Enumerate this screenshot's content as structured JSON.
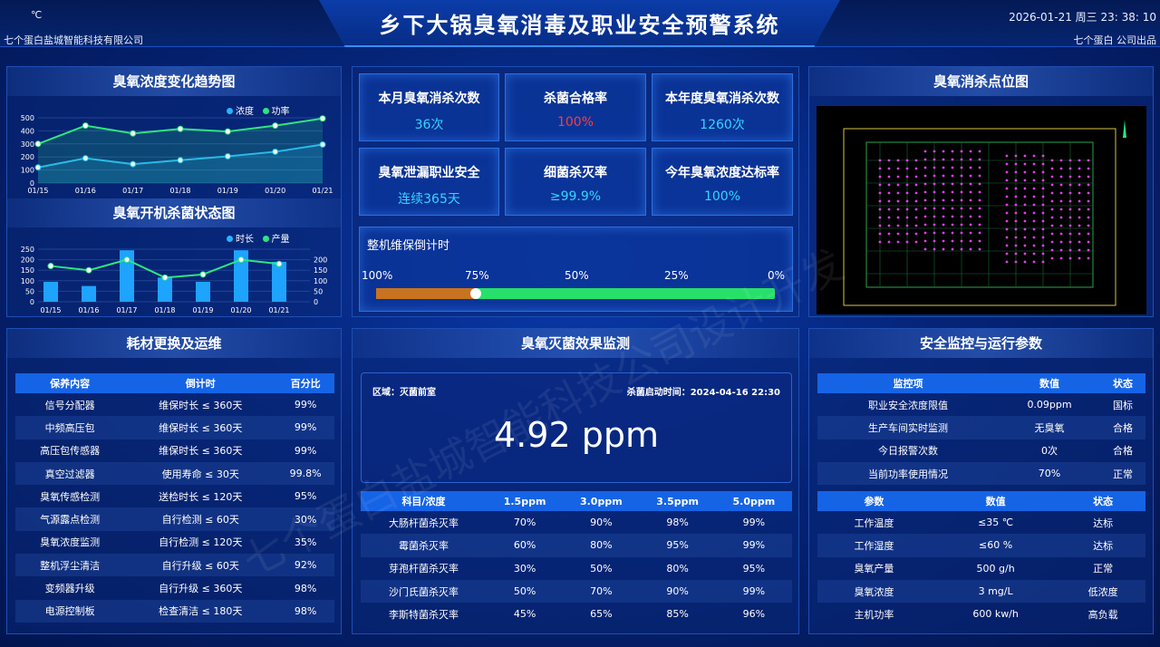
{
  "header": {
    "title": "乡下大锅臭氧消毒及职业安全预警系统",
    "weather_unit": "℃",
    "company": "七个蛋白盐城智能科技有限公司",
    "datetime": "2026-01-21 周三 23: 38: 10",
    "made_by": "七个蛋白 公司出品",
    "watermark": "七个蛋白盐城智能科技公司设计开发"
  },
  "trend": {
    "title": "臭氧浓度变化趋势图",
    "legend": [
      "浓度",
      "功率"
    ],
    "colors": [
      "#27b3ff",
      "#2ee57f"
    ]
  },
  "status": {
    "title": "臭氧开机杀菌状态图",
    "legend": [
      "时长",
      "产量"
    ]
  },
  "chart_data": [
    {
      "type": "area",
      "title": "臭氧浓度变化趋势图",
      "x": [
        "01/15",
        "01/16",
        "01/17",
        "01/18",
        "01/19",
        "01/20",
        "01/21"
      ],
      "ylim": [
        0,
        500
      ],
      "yticks": [
        0,
        100,
        200,
        300,
        400,
        500
      ],
      "series": [
        {
          "name": "浓度",
          "values": [
            120,
            190,
            145,
            175,
            205,
            240,
            295
          ]
        },
        {
          "name": "功率",
          "values": [
            300,
            440,
            380,
            415,
            395,
            440,
            495
          ]
        }
      ]
    },
    {
      "type": "bar",
      "title": "臭氧开机杀菌状态图",
      "x": [
        "01/15",
        "01/16",
        "01/17",
        "01/18",
        "01/19",
        "01/20",
        "01/21"
      ],
      "ylim": [
        0,
        250
      ],
      "yticks": [
        0,
        50,
        100,
        150,
        200,
        250
      ],
      "y2ticks": [
        0,
        50,
        100,
        150,
        200
      ],
      "series": [
        {
          "name": "时长",
          "values": [
            95,
            75,
            245,
            115,
            95,
            245,
            190
          ]
        },
        {
          "name": "产量",
          "values": [
            170,
            150,
            200,
            115,
            130,
            200,
            180
          ]
        }
      ]
    }
  ],
  "kpis": [
    {
      "label": "本月臭氧消杀次数",
      "value": "36次",
      "color": "#33d6ff"
    },
    {
      "label": "杀菌合格率",
      "value": "100%",
      "color": "#ff3c3c"
    },
    {
      "label": "本年度臭氧消杀次数",
      "value": "1260次",
      "color": "#33d6ff"
    },
    {
      "label": "臭氧泄漏职业安全",
      "value": "连续365天",
      "color": "#33d6ff"
    },
    {
      "label": "细菌杀灭率",
      "value": "≥99.9%",
      "color": "#33d6ff"
    },
    {
      "label": "今年臭氧浓度达标率",
      "value": "100%",
      "color": "#33d6ff"
    }
  ],
  "maintenance": {
    "title": "整机维保倒计时",
    "ticks": [
      "100%",
      "75%",
      "50%",
      "25%",
      "0%"
    ],
    "progress": 0.75
  },
  "map": {
    "title": "臭氧消杀点位图"
  },
  "consumables": {
    "title": "耗材更换及运维",
    "headers": [
      "保养内容",
      "倒计时",
      "百分比"
    ],
    "rows": [
      [
        "信号分配器",
        "维保时长 ≤ 360天",
        "99%"
      ],
      [
        "中频高压包",
        "维保时长 ≤ 360天",
        "99%"
      ],
      [
        "高压包传感器",
        "维保时长 ≤ 360天",
        "99%"
      ],
      [
        "真空过滤器",
        "使用寿命 ≤ 30天",
        "99.8%"
      ],
      [
        "臭氧传感检测",
        "送检时长 ≤ 120天",
        "95%"
      ],
      [
        "气源露点检测",
        "自行检测 ≤ 60天",
        "30%"
      ],
      [
        "臭氧浓度监测",
        "自行检测 ≤ 120天",
        "35%"
      ],
      [
        "整机浮尘清洁",
        "自行升级 ≤ 60天",
        "92%"
      ],
      [
        "变频器升级",
        "自行升级 ≤ 360天",
        "98%"
      ],
      [
        "电源控制板",
        "检查清洁 ≤ 180天",
        "98%"
      ]
    ]
  },
  "effect": {
    "title": "臭氧灭菌效果监测",
    "area": "区域：灭菌前室",
    "start": "杀菌启动时间：2024-04-16 22:30",
    "value": "4.92 ppm",
    "headers": [
      "科目/浓度",
      "1.5ppm",
      "3.0ppm",
      "3.5ppm",
      "5.0ppm"
    ],
    "rows": [
      [
        "大肠杆菌杀灭率",
        "70%",
        "90%",
        "98%",
        "99%"
      ],
      [
        "霉菌杀灭率",
        "60%",
        "80%",
        "95%",
        "99%"
      ],
      [
        "芽孢杆菌杀灭率",
        "30%",
        "50%",
        "80%",
        "95%"
      ],
      [
        "沙门氏菌杀灭率",
        "50%",
        "70%",
        "90%",
        "99%"
      ],
      [
        "李斯特菌杀灭率",
        "45%",
        "65%",
        "85%",
        "96%"
      ]
    ]
  },
  "safety": {
    "title": "安全监控与运行参数",
    "h1": [
      "监控项",
      "数值",
      "状态"
    ],
    "rows1": [
      [
        "职业安全浓度限值",
        "0.09ppm",
        "国标"
      ],
      [
        "生产车间实时监测",
        "无臭氧",
        "合格"
      ],
      [
        "今日报警次数",
        "0次",
        "合格"
      ],
      [
        "当前功率使用情况",
        "70%",
        "正常"
      ]
    ],
    "h2": [
      "参数",
      "数值",
      "状态"
    ],
    "rows2": [
      [
        "工作温度",
        "≤35 ℃",
        "达标"
      ],
      [
        "工作湿度",
        "≤60 %",
        "达标"
      ],
      [
        "臭氧产量",
        "500 g/h",
        "正常"
      ],
      [
        "臭氧浓度",
        "3 mg/L",
        "低浓度"
      ],
      [
        "主机功率",
        "600 kw/h",
        "高负载"
      ]
    ]
  }
}
